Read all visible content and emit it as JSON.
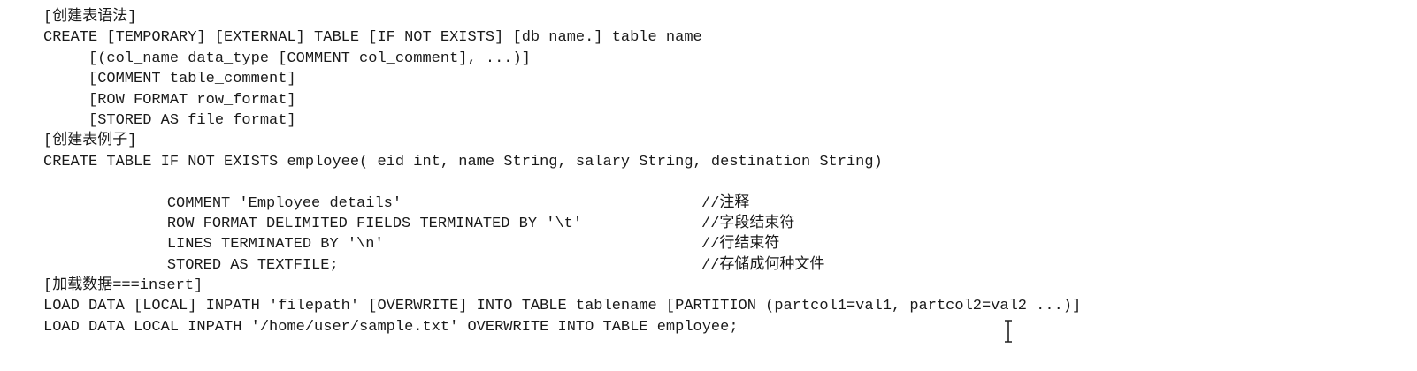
{
  "create_syntax": {
    "heading": "[创建表语法]",
    "lines": [
      "CREATE [TEMPORARY] [EXTERNAL] TABLE [IF NOT EXISTS] [db_name.] table_name",
      "[(col_name data_type [COMMENT col_comment], ...)]",
      "[COMMENT table_comment]",
      "[ROW FORMAT row_format]",
      "[STORED AS file_format]"
    ]
  },
  "create_example": {
    "heading": "[创建表例子]",
    "statement": "CREATE TABLE IF NOT EXISTS employee( eid int, name String, salary String, destination String)",
    "clauses": [
      {
        "code": "COMMENT 'Employee details'",
        "comment": "//注释"
      },
      {
        "code": "ROW FORMAT DELIMITED FIELDS TERMINATED BY '\\t'",
        "comment": "//字段结束符"
      },
      {
        "code": "LINES TERMINATED BY '\\n'",
        "comment": "//行结束符"
      },
      {
        "code": "STORED AS TEXTFILE;",
        "comment": "//存储成何种文件"
      }
    ]
  },
  "load_data": {
    "heading": "[加载数据===insert]",
    "lines": [
      "LOAD DATA [LOCAL] INPATH 'filepath' [OVERWRITE] INTO TABLE tablename [PARTITION (partcol1=val1, partcol2=val2 ...)]",
      "LOAD DATA LOCAL INPATH '/home/user/sample.txt' OVERWRITE INTO TABLE employee;"
    ]
  },
  "cursor_icon": "text-cursor-icon"
}
